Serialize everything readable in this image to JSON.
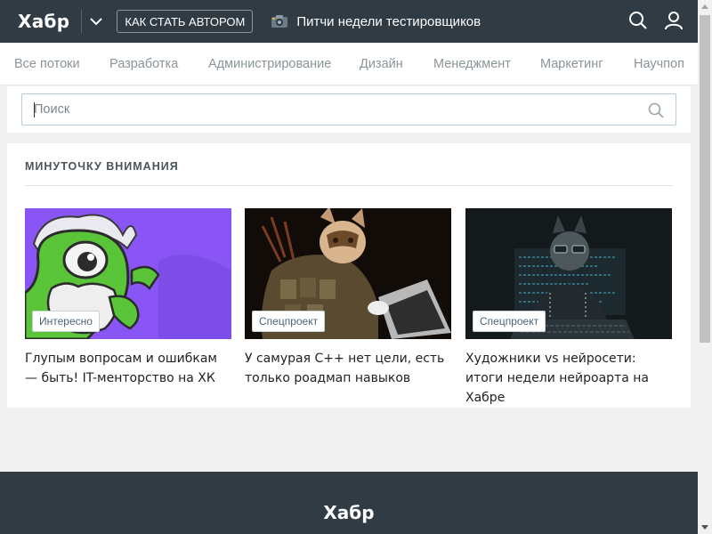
{
  "header": {
    "logo": "Хабр",
    "author_button": "КАК СТАТЬ АВТОРОМ",
    "promo_text": "Питчи недели тестировщиков",
    "icons": [
      "chevron-down-icon",
      "camera-icon",
      "search-icon",
      "user-icon"
    ]
  },
  "nav": {
    "items": [
      "Все потоки",
      "Разработка",
      "Администрирование",
      "Дизайн",
      "Менеджмент",
      "Маркетинг",
      "Научпоп"
    ]
  },
  "search": {
    "placeholder": "Поиск",
    "value": ""
  },
  "attention": {
    "title": "МИНУТОЧКУ ВНИМАНИЯ",
    "cards": [
      {
        "badge": "Интересно",
        "title": "Глупым вопросам и ошибкам — быть! IT-менторство на ХК"
      },
      {
        "badge": "Спецпроект",
        "title": "У самурая C++ нет цели, есть только роадмап навыков"
      },
      {
        "badge": "Спецпроект",
        "title": "Художники vs нейросети: итоги недели нейроарта на Хабре"
      }
    ]
  },
  "footer": {
    "logo": "Хабр"
  },
  "colors": {
    "header_bg": "#303b44",
    "page_bg": "#f0f0f0",
    "nav_text": "#8a9499",
    "badge_text": "#4b6477",
    "card1_bg": "#8a55f5"
  }
}
